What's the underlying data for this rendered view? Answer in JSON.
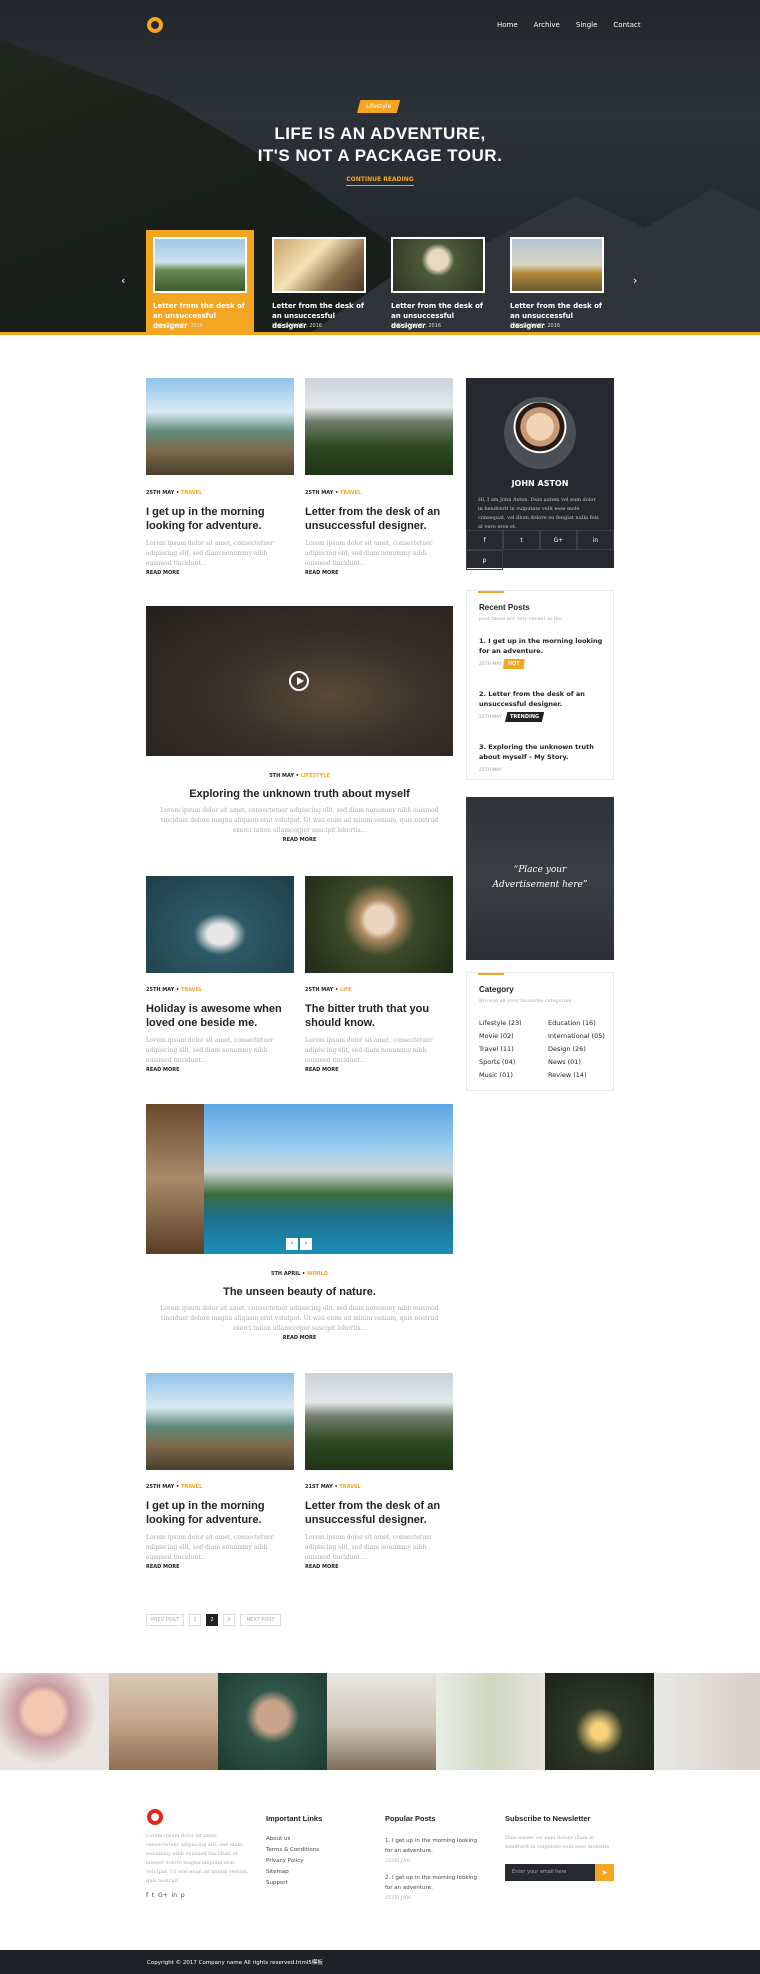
{
  "nav": {
    "items": [
      "Home",
      "Archive",
      "Single",
      "Contact"
    ]
  },
  "hero": {
    "badge": "Lifestyle",
    "title_line1": "LIFE IS AN ADVENTURE,",
    "title_line2": "IT'S NOT A PACKAGE TOUR.",
    "cta": "CONTINUE READING",
    "cards": [
      {
        "title": "Letter from the desk of an unsuccessful designer",
        "date": "2ND JANUARY, 2016"
      },
      {
        "title": "Letter from the desk of an unsuccessful designer",
        "date": "2ND JANUARY, 2016"
      },
      {
        "title": "Letter from the desk of an unsuccessful designer",
        "date": "2ND JANUARY, 2016"
      },
      {
        "title": "Letter from the desk of an unsuccessful designer",
        "date": "2ND JANUARY, 2016"
      }
    ]
  },
  "excerpt_short": "Lorem ipsum dolor sit amet, consectetuer adipiscing elit, sed diam nonummy nibh euismod tincidunt...",
  "excerpt_long": "Lorem ipsum dolor sit amet, consectetuer adipiscing elit, sed diam nonummy nibh euismod tincidunt dolore magna aliquam erat volutpat. Ut wisi enim ad minim veniam, quis nostrud exerci tation ullamcorper suscipit lobortis...",
  "read_more": "READ MORE",
  "posts": {
    "p1": {
      "date": "25TH MAY",
      "cat": "TRAVEL",
      "title": "I get up in the morning looking for adventure."
    },
    "p2": {
      "date": "25TH MAY",
      "cat": "TRAVEL",
      "title": "Letter from the desk of an unsuccessful designer."
    },
    "p3": {
      "date": "5TH MAY",
      "cat": "LIFESTYLE",
      "title": "Exploring the unknown truth about myself"
    },
    "p4": {
      "date": "25TH MAY",
      "cat": "TRAVEL",
      "title": "Holiday is awesome when loved one beside me."
    },
    "p5": {
      "date": "25TH MAY",
      "cat": "LIFE",
      "title": "The bitter truth that you should know."
    },
    "p6": {
      "date": "5TH APRIL",
      "cat": "WORLD",
      "title": "The unseen beauty of nature."
    },
    "p7": {
      "date": "25TH MAY",
      "cat": "TRAVEL",
      "title": "I get up in the morning looking for adventure."
    },
    "p8": {
      "date": "21ST MAY",
      "cat": "TRAVEL",
      "title": "Letter from the desk of an unsuccessful designer."
    }
  },
  "author": {
    "name": "JOHN ASTON",
    "bio": "Hi, I am John Aston. Duis autem vel eum dolor in hendrerit in vulputate velit esse mole consequat, vel illum dolore eu feugiat nulla fols at vero eros et."
  },
  "recent": {
    "title": "Recent Posts",
    "subtitle": "post these are very recent in the",
    "items": [
      {
        "title": "1. I get up in the morning looking for an adventure.",
        "date": "25TH MAY",
        "tag": "HOT"
      },
      {
        "title": "2. Letter from the desk of an unsuccessful designer.",
        "date": "25TH MAY",
        "tag": "TRENDING"
      },
      {
        "title": "3. Exploring the unknown truth about myself - My Story.",
        "date": "25TH MAY",
        "tag": ""
      }
    ]
  },
  "ad": {
    "line1": "“Place your",
    "line2": "Advertisement here”"
  },
  "category": {
    "title": "Category",
    "subtitle": "Browse all your favourite categories",
    "left": [
      "Lifestyle (23)",
      "Movie (02)",
      "Travel (11)",
      "Sports (04)",
      "Music (01)"
    ],
    "right": [
      "Education (16)",
      "International (05)",
      "Design (26)",
      "News (01)",
      "Review (14)"
    ]
  },
  "pagination": {
    "prev": "PREV POST",
    "pages": [
      "1",
      "2",
      "3"
    ],
    "next": "NEXT POST"
  },
  "footer": {
    "about": "Lorem ipsum dolor sit amet, consectetuer adipiscing elit, sed diam nonummy nibh euismod tincidunt ut laoreet dolore magna aliquam erat volutpat. Ut wisi enim ad minim veniam, quis nostrud.",
    "links_title": "Important Links",
    "links": [
      "About us",
      "Terms & Conditions",
      "Privacy Policy",
      "Sitemap",
      "Support"
    ],
    "popular_title": "Popular Posts",
    "popular": [
      {
        "title": "1. I get up in the morning looking for an adventure.",
        "date": "25TH JAN"
      },
      {
        "title": "2. I get up in the morning looking for an adventure.",
        "date": "25TH JAN"
      }
    ],
    "newsletter_title": "Subscribe to Newsletter",
    "newsletter_text": "Duis autem vel eum dolore illum in hendrerit in vulputate velit esse molestie",
    "email_placeholder": "Enter your email here",
    "copyright": "Copyright © 2017 Company name All rights reserved.html5模板"
  },
  "colors": {
    "accent": "#f4a623",
    "dark": "#262a2f"
  }
}
